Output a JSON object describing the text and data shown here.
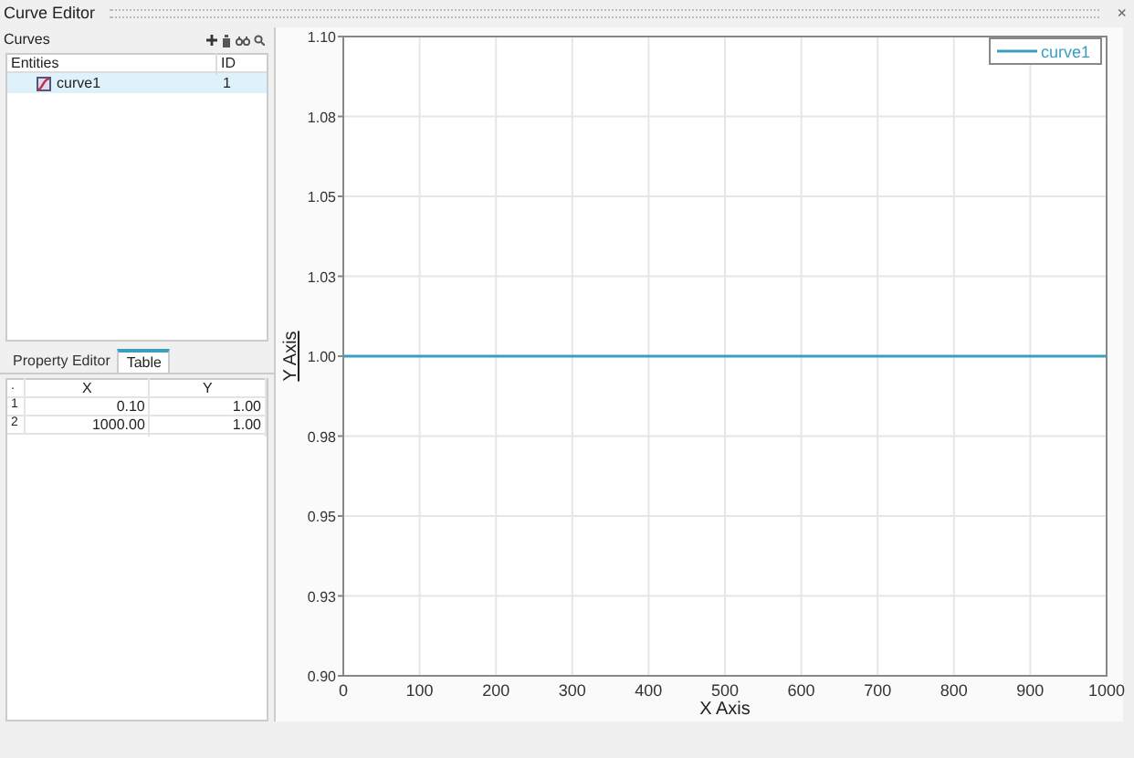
{
  "window": {
    "title": "Curve Editor",
    "close": "×"
  },
  "curves_panel": {
    "title": "Curves",
    "columns": [
      "Entities",
      "ID"
    ],
    "rows": [
      {
        "name": "curve1",
        "id": "1",
        "selected": true
      }
    ]
  },
  "tabs": [
    {
      "label": "Property Editor",
      "selected": false
    },
    {
      "label": "Table",
      "selected": true
    }
  ],
  "table": {
    "columns": [
      ".",
      "X",
      "Y"
    ],
    "rows": [
      [
        "1",
        "0.10",
        "1.00"
      ],
      [
        "2",
        "1000.00",
        "1.00"
      ]
    ]
  },
  "chart": {
    "chart_data": {
      "type": "line",
      "xlabel": "X Axis",
      "ylabel": "Y Axis",
      "x": [
        0.1,
        1000
      ],
      "series": [
        {
          "name": "curve1",
          "color": "#3a9ec0",
          "values": [
            1.0,
            1.0
          ]
        }
      ],
      "grid": true,
      "xlim": [
        0,
        1000
      ],
      "ylim": [
        0.9,
        1.1
      ],
      "xticks": [
        0,
        100,
        200,
        300,
        400,
        500,
        600,
        700,
        800,
        900,
        1000
      ],
      "yticks": [
        {
          "value": 0.9,
          "label": "0.90"
        },
        {
          "value": 0.925,
          "label": "0.93"
        },
        {
          "value": 0.95,
          "label": "0.95"
        },
        {
          "value": 0.975,
          "label": "0.98"
        },
        {
          "value": 1.0,
          "label": "1.00"
        },
        {
          "value": 1.025,
          "label": "1.03"
        },
        {
          "value": 1.05,
          "label": "1.05"
        },
        {
          "value": 1.075,
          "label": "1.08"
        },
        {
          "value": 1.1,
          "label": "1.10"
        }
      ]
    }
  }
}
